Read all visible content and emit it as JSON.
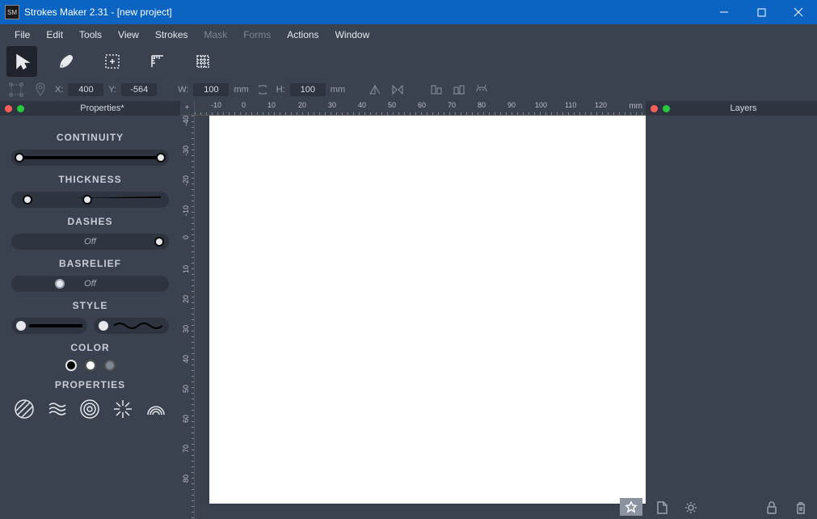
{
  "window": {
    "title": "Strokes Maker 2.31 - [new project]"
  },
  "menu": {
    "items": [
      "File",
      "Edit",
      "Tools",
      "View",
      "Strokes",
      "Mask",
      "Forms",
      "Actions",
      "Window"
    ],
    "disabled_index": [
      5,
      6
    ]
  },
  "coordbar": {
    "x_label": "X:",
    "x_value": "400",
    "y_label": "Y:",
    "y_value": "-564",
    "w_label": "W:",
    "w_value": "100",
    "w_unit": "mm",
    "h_label": "H:",
    "h_value": "100",
    "h_unit": "mm"
  },
  "properties": {
    "panel_title": "Properties*",
    "continuity_label": "CONTINUITY",
    "thickness_label": "THICKNESS",
    "dashes_label": "DASHES",
    "dashes_value": "Off",
    "basrelief_label": "BASRELIEF",
    "basrelief_value": "Off",
    "style_label": "STYLE",
    "color_label": "COLOR",
    "properties_label": "PROPERTIES"
  },
  "layers": {
    "panel_title": "Layers"
  },
  "ruler": {
    "unit": "mm",
    "h_ticks": [
      "-10",
      "0",
      "10",
      "20",
      "30",
      "40",
      "50",
      "60",
      "70",
      "80",
      "90",
      "100",
      "110",
      "120"
    ],
    "v_ticks": [
      "-40",
      "-30",
      "-20",
      "-10",
      "0",
      "10",
      "20",
      "30",
      "40",
      "50",
      "60",
      "70",
      "80"
    ]
  },
  "colors": {
    "titlebar_bg": "#0b63c2",
    "panel_bg": "#3a4250",
    "dark_bg": "#2e3440",
    "text": "#e6e8eb"
  }
}
